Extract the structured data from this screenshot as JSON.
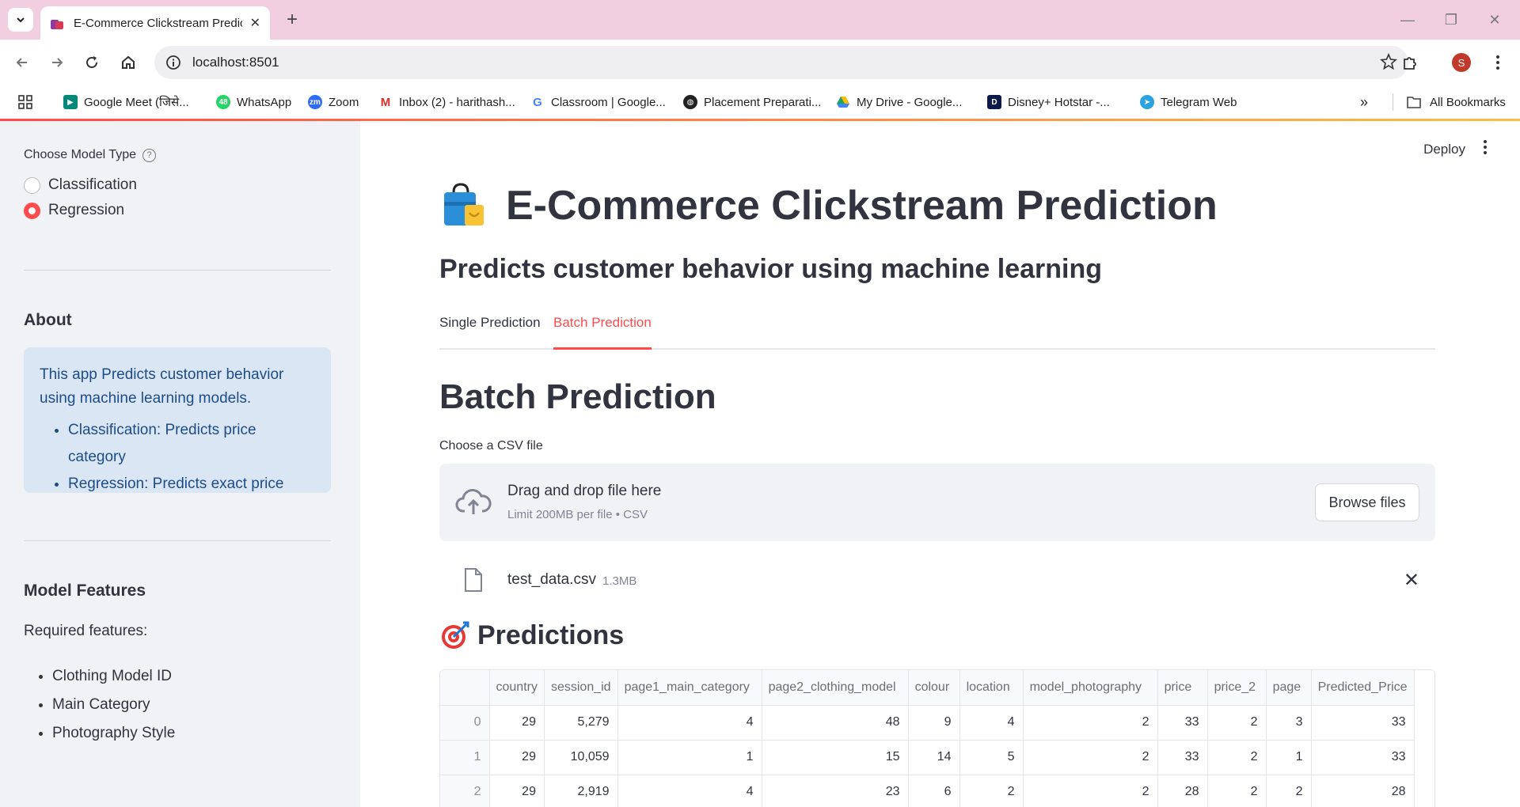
{
  "browser": {
    "tab_title": "E-Commerce Clickstream Predic",
    "url": "localhost:8501",
    "profile_initial": "S",
    "bookmarks": [
      "Google Meet (जिसे...",
      "WhatsApp",
      "Zoom",
      "Inbox (2) - harithash...",
      "Classroom | Google...",
      "Placement Preparati...",
      "My Drive - Google...",
      "Disney+ Hotstar -...",
      "Telegram Web"
    ],
    "all_bookmarks": "All Bookmarks",
    "whatsapp_badge": "48"
  },
  "sidebar": {
    "model_type_label": "Choose Model Type",
    "options": [
      "Classification",
      "Regression"
    ],
    "selected": "Regression",
    "about_heading": "About",
    "about_text": "This app Predicts customer behavior using machine learning models.",
    "about_items": [
      "Classification: Predicts price category",
      "Regression: Predicts exact price"
    ],
    "features_heading": "Model Features",
    "required_label": "Required features:",
    "features": [
      "Clothing Model ID",
      "Main Category",
      "Photography Style"
    ]
  },
  "header": {
    "deploy": "Deploy"
  },
  "main": {
    "title": "E-Commerce Clickstream Prediction",
    "subtitle": "Predicts customer behavior using machine learning",
    "tabs": [
      "Single Prediction",
      "Batch Prediction"
    ],
    "active_tab": "Batch Prediction",
    "section_title": "Batch Prediction",
    "file_label": "Choose a CSV file",
    "drop_text": "Drag and drop file here",
    "limit_text": "Limit 200MB per file • CSV",
    "browse_label": "Browse files",
    "file_name": "test_data.csv",
    "file_size": "1.3MB",
    "predictions_title": "Predictions"
  },
  "table": {
    "columns": [
      "country",
      "session_id",
      "page1_main_category",
      "page2_clothing_model",
      "colour",
      "location",
      "model_photography",
      "price",
      "price_2",
      "page",
      "Predicted_Price"
    ],
    "rows": [
      {
        "index": "0",
        "cells": [
          "29",
          "5,279",
          "4",
          "48",
          "9",
          "4",
          "2",
          "33",
          "2",
          "3",
          "33"
        ]
      },
      {
        "index": "1",
        "cells": [
          "29",
          "10,059",
          "1",
          "15",
          "14",
          "5",
          "2",
          "33",
          "2",
          "1",
          "33"
        ]
      },
      {
        "index": "2",
        "cells": [
          "29",
          "2,919",
          "4",
          "23",
          "6",
          "2",
          "2",
          "28",
          "2",
          "2",
          "28"
        ]
      }
    ]
  },
  "colors": {
    "accent": "#ff4b4b",
    "info_bg": "#dbe6f4",
    "info_text": "#1c4c89",
    "sidebar_bg": "#f0f2f6"
  }
}
